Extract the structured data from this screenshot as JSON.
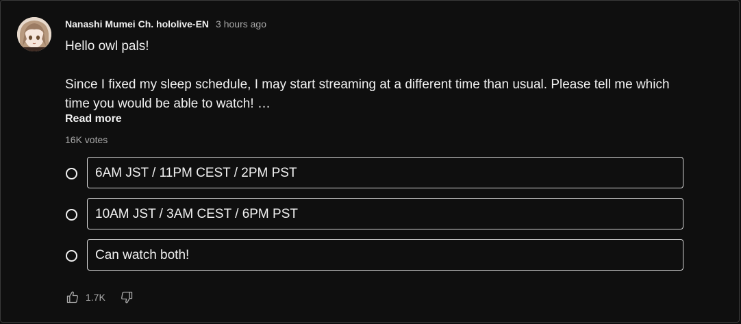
{
  "post": {
    "author": "Nanashi Mumei Ch. hololive-EN",
    "time": "3 hours ago",
    "text_line1": "Hello owl pals!",
    "text_line2": "Since I fixed my sleep schedule, I may start streaming at a different time than usual. Please tell me which time you would be able to watch!",
    "ellipsis": "…",
    "read_more": "Read more",
    "votes": "16K votes"
  },
  "poll": {
    "options": [
      {
        "label": "6AM JST / 11PM CEST / 2PM PST"
      },
      {
        "label": "10AM JST / 3AM CEST / 6PM PST"
      },
      {
        "label": "Can watch both!"
      }
    ]
  },
  "actions": {
    "like_icon": "thumbs-up-icon",
    "like_count": "1.7K",
    "dislike_icon": "thumbs-down-icon"
  },
  "colors": {
    "background": "#0f0f0f",
    "text": "#f1f1f1",
    "secondary_text": "#aaaaaa",
    "border": "#3a3a3a"
  }
}
